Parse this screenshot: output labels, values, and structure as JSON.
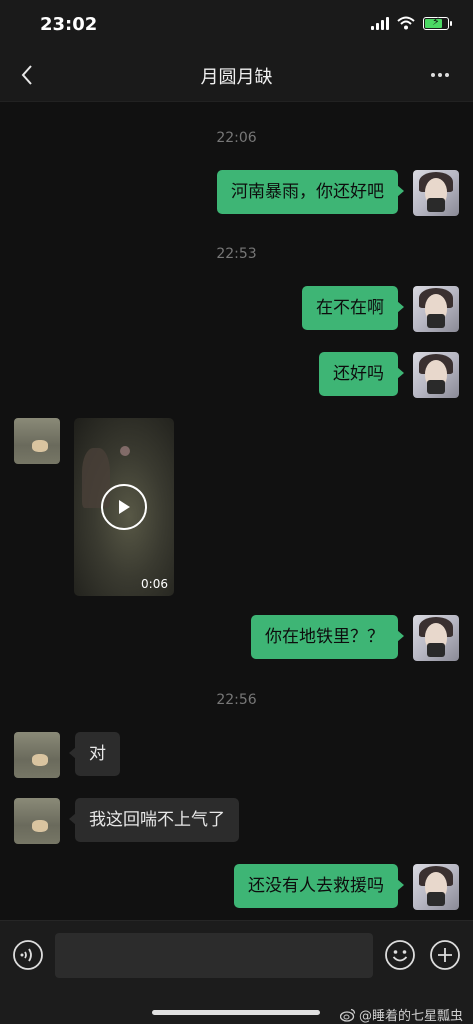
{
  "status_bar": {
    "time": "23:02",
    "battery_level": 0.8
  },
  "nav": {
    "title": "月圆月缺"
  },
  "chat": {
    "timestamps": [
      "22:06",
      "22:53",
      "22:56"
    ],
    "messages": [
      {
        "sender": "me",
        "text": "河南暴雨，你还好吧"
      },
      {
        "sender": "me",
        "text": "在不在啊"
      },
      {
        "sender": "me",
        "text": "还好吗"
      },
      {
        "sender": "other",
        "type": "video",
        "duration": "0:06"
      },
      {
        "sender": "me",
        "text": "你在地铁里？？"
      },
      {
        "sender": "other",
        "text": "对"
      },
      {
        "sender": "other",
        "text": "我这回喘不上气了"
      },
      {
        "sender": "me",
        "text": "还没有人去救援吗"
      }
    ]
  },
  "input": {
    "value": "",
    "placeholder": ""
  },
  "watermark": "@睡着的七星瓢虫",
  "colors": {
    "accent_bubble": "#3eb575",
    "background": "#111111",
    "other_bubble": "#2c2c2c"
  },
  "icons": [
    "back-icon",
    "more-icon",
    "voice-icon",
    "emoji-icon",
    "add-icon",
    "play-icon",
    "weibo-icon"
  ]
}
